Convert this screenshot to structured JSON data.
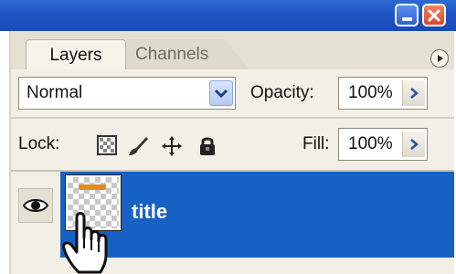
{
  "window": {
    "minimize_icon": "minimize-icon",
    "close_icon": "close-icon",
    "titlebar_color": "#1f55c4"
  },
  "tabs": [
    {
      "label": "Layers",
      "active": true
    },
    {
      "label": "Channels",
      "active": false
    }
  ],
  "panel_menu_icon": "panel-menu-icon",
  "blend_mode": {
    "value": "Normal",
    "icon": "chevron-down-icon"
  },
  "opacity": {
    "label": "Opacity:",
    "value": "100%"
  },
  "lock": {
    "label": "Lock:",
    "icons": [
      "lock-transparent-pixels-icon",
      "lock-image-pixels-icon",
      "lock-position-icon",
      "lock-all-icon"
    ]
  },
  "fill": {
    "label": "Fill:",
    "value": "100%"
  },
  "layers": [
    {
      "name": "title",
      "visible": true,
      "selected": true,
      "selection_color": "#1661c4"
    }
  ],
  "cursor": "hand-cursor-icon"
}
